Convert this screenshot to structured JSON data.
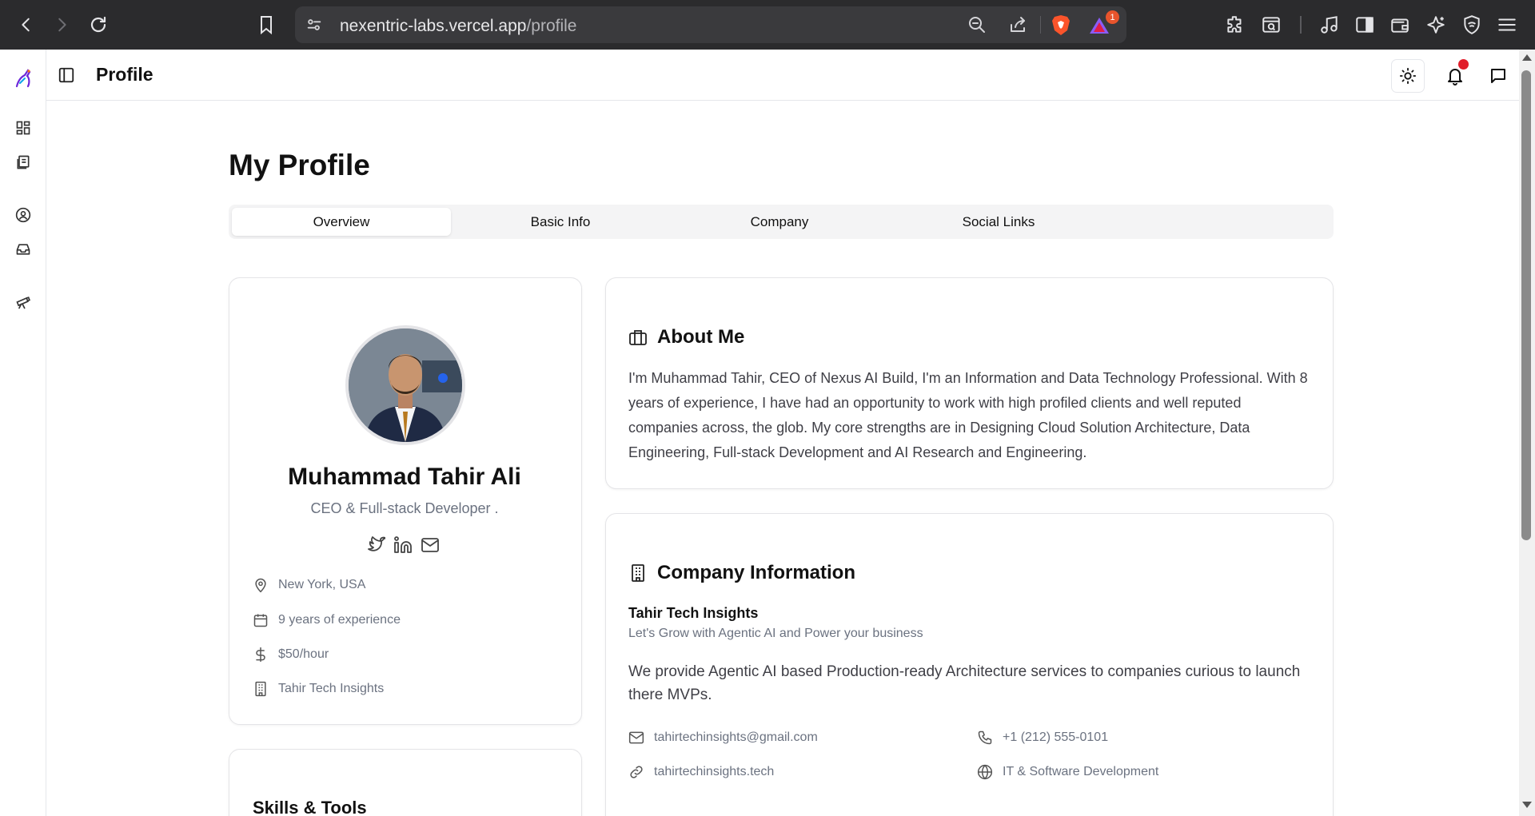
{
  "browser": {
    "url_host": "nexentric-labs.vercel.app",
    "url_path": "/profile",
    "brave_rewards_badge": "1"
  },
  "header": {
    "title": "Profile"
  },
  "page": {
    "title": "My Profile",
    "tabs": [
      {
        "label": "Overview",
        "active": true
      },
      {
        "label": "Basic Info",
        "active": false
      },
      {
        "label": "Company",
        "active": false
      },
      {
        "label": "Social Links",
        "active": false
      }
    ]
  },
  "profile_card": {
    "name": "Muhammad Tahir Ali",
    "role": "CEO & Full-stack Developer .",
    "social_icons": [
      "twitter-icon",
      "linkedin-icon",
      "mail-icon"
    ],
    "details": [
      {
        "icon": "map-pin-icon",
        "text": "New York, USA"
      },
      {
        "icon": "calendar-icon",
        "text": "9 years of experience"
      },
      {
        "icon": "dollar-icon",
        "text": "$50/hour"
      },
      {
        "icon": "building-icon",
        "text": "Tahir Tech Insights"
      }
    ]
  },
  "skills_card": {
    "title": "Skills & Tools"
  },
  "about": {
    "title": "About Me",
    "text": "I'm Muhammad Tahir, CEO of Nexus AI Build, I'm an Information and Data Technology Professional. With 8 years of experience, I have had an opportunity to work with high profiled clients and well reputed companies across, the glob. My core strengths are in Designing Cloud Solution Architecture, Data Engineering, Full-stack Development and AI Research and Engineering."
  },
  "company": {
    "title": "Company Information",
    "name": "Tahir Tech Insights",
    "tagline": "Let's Grow with Agentic AI and Power your business",
    "description": "We provide Agentic AI based Production-ready Architecture services to companies curious to launch there MVPs.",
    "email": "tahirtechinsights@gmail.com",
    "phone": "+1 (212) 555-0101",
    "website": "tahirtechinsights.tech",
    "industry": "IT & Software Development"
  },
  "colors": {
    "chrome_bg": "#2b2b2d",
    "notification_dot": "#e11d2a",
    "brave_orange": "#fb542b",
    "muted_text": "#6b7280"
  }
}
